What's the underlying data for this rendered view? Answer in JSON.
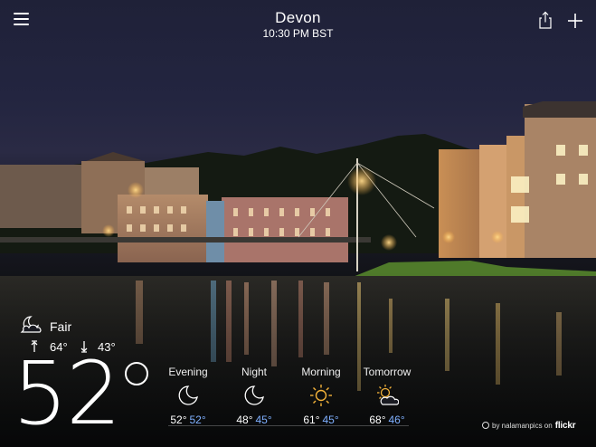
{
  "header": {
    "city": "Devon",
    "time": "10:30 PM BST"
  },
  "current": {
    "condition": "Fair",
    "condition_icon": "moon-cloud-icon",
    "high": "64°",
    "low": "43°",
    "temperature": "52"
  },
  "forecast": [
    {
      "label": "Evening",
      "icon": "moon-icon",
      "high": "52°",
      "low": "52°"
    },
    {
      "label": "Night",
      "icon": "moon-icon",
      "high": "48°",
      "low": "45°"
    },
    {
      "label": "Morning",
      "icon": "sun-icon",
      "high": "61°",
      "low": "45°"
    },
    {
      "label": "Tomorrow",
      "icon": "sun-cloud-icon",
      "high": "68°",
      "low": "46°"
    }
  ],
  "credit": {
    "by": "by nalamanpics on",
    "source": "flickr"
  },
  "colors": {
    "low_temp": "#7fb0ff",
    "sun": "#f3b23a"
  }
}
